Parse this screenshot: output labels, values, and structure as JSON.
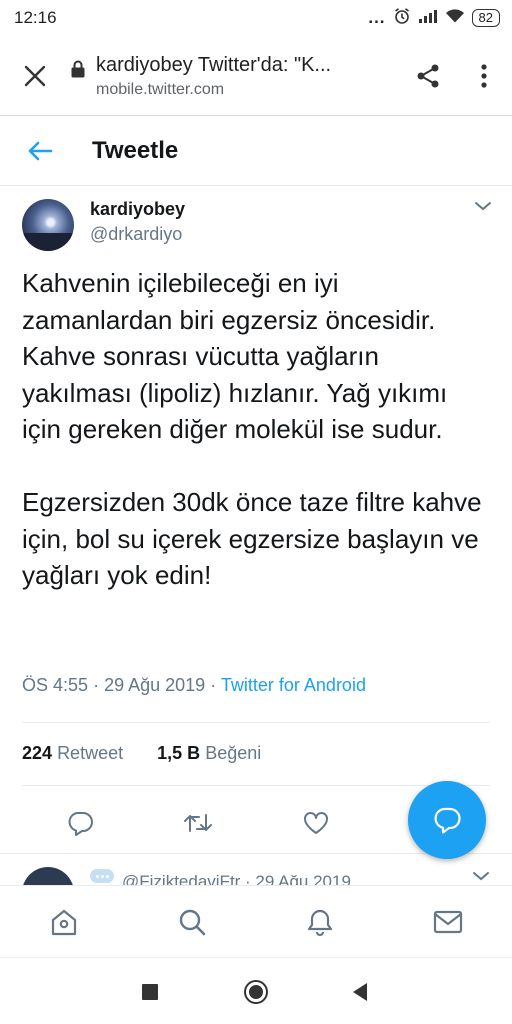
{
  "status_bar": {
    "time": "12:16",
    "more": "...",
    "battery": "82"
  },
  "browser": {
    "title": "kardiyobey Twitter'da: \"K...",
    "domain": "mobile.twitter.com"
  },
  "header": {
    "title": "Tweetle"
  },
  "tweet": {
    "display_name": "kardiyobey",
    "handle": "@drkardiyo",
    "text_p1": "Kahvenin içilebileceği en iyi zamanlardan biri egzersiz öncesidir. Kahve sonrası vücutta yağların yakılması (lipoliz) hızlanır. Yağ yıkımı için gereken diğer molekül ise sudur.",
    "text_p2": "Egzersizden 30dk önce taze filtre kahve için, bol su içerek egzersize başlayın ve yağları yok edin!",
    "time": "ÖS 4:55",
    "date": "29 Ağu 2019",
    "separator": "·",
    "client": "Twitter for Android",
    "retweet_count": "224",
    "retweet_label": "Retweet",
    "like_count": "1,5 B",
    "like_label": "Beğeni"
  },
  "next_tweet": {
    "preview": "@FiziktedaviFtr · 29 Ağu 2019"
  },
  "colors": {
    "accent": "#1da1f2",
    "text": "#14171a",
    "secondary": "#657786"
  }
}
